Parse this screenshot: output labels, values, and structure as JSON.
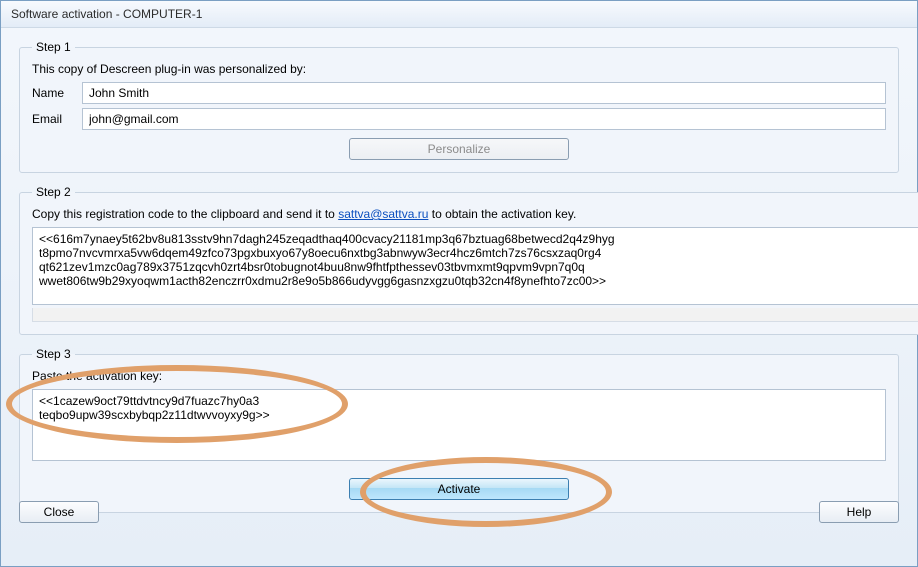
{
  "window": {
    "title": "Software activation - COMPUTER-1"
  },
  "step1": {
    "legend": "Step 1",
    "intro": "This copy of Descreen plug-in was personalized by:",
    "name_label": "Name",
    "name_value": "John Smith",
    "email_label": "Email",
    "email_value": "john@gmail.com",
    "personalize_label": "Personalize"
  },
  "step2": {
    "legend": "Step 2",
    "intro_before": "Copy this registration code to the clipboard and send it to ",
    "link_text": "sattva@sattva.ru",
    "intro_after": " to obtain the activation key.",
    "code": "<<616m7ynaey5t62bv8u813sstv9hn7dagh245zeqadthaq400cvacy21181mp3q67bztuag68betwecd2q4z9hyg\nt8pmo7nvcvmrxa5vw6dqem49zfco73pgxbuxyo67y8oecu6nxtbg3abnwyw3ecr4hcz6mtch7zs76csxzaq0rg4\nqt621zev1mzc0ag789x3751zqcvh0zrt4bsr0tobugnot4buu8nw9fhtfpthessev03tbvmxmt9qpvm9vpn7q0q\nwwet806tw9b29xyoqwm1acth82enczrr0xdmu2r8e9o5b866udyvgg6gasnzxgzu0tqb32cn4f8ynefhto7zc00>>"
  },
  "step3": {
    "legend": "Step 3",
    "intro": "Paste the activation key:",
    "key": "<<1cazew9oct79ttdvtncy9d7fuazc7hy0a3\nteqbo9upw39scxbybqp2z11dtwvvoyxy9g>>",
    "activate_label": "Activate"
  },
  "footer": {
    "close_label": "Close",
    "help_label": "Help"
  }
}
